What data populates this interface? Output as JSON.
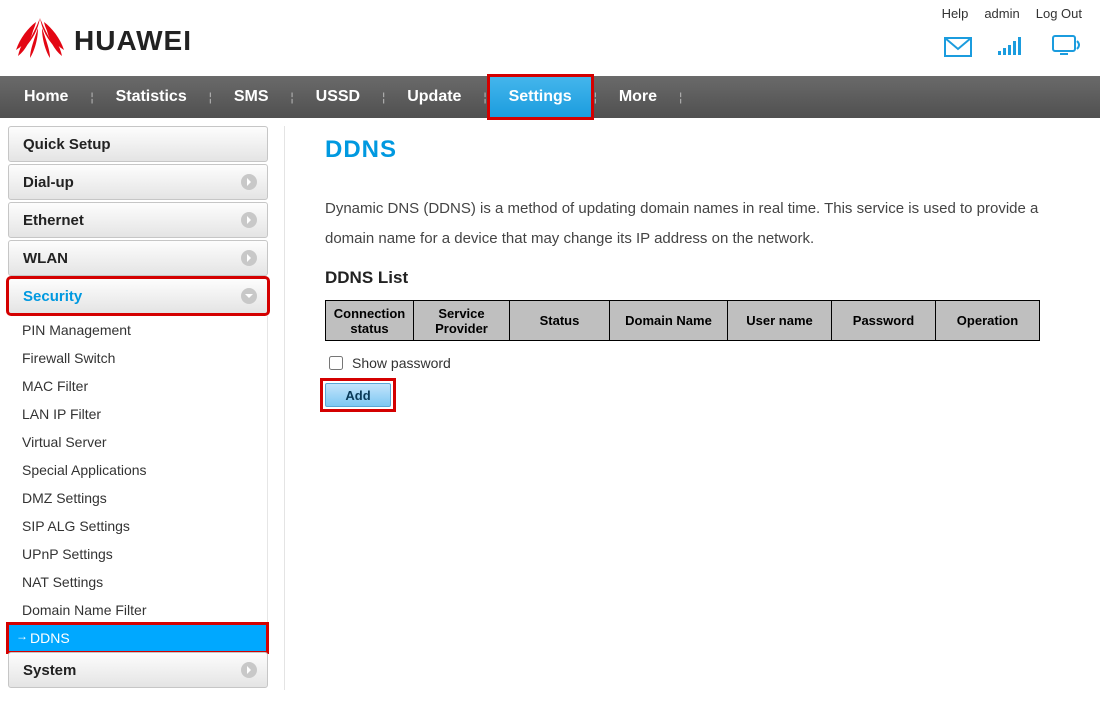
{
  "header": {
    "brand": "HUAWEI",
    "links": {
      "help": "Help",
      "user": "admin",
      "logout": "Log Out"
    }
  },
  "nav": {
    "home": "Home",
    "statistics": "Statistics",
    "sms": "SMS",
    "ussd": "USSD",
    "update": "Update",
    "settings": "Settings",
    "more": "More"
  },
  "sidebar": {
    "quick_setup": "Quick Setup",
    "dialup": "Dial-up",
    "ethernet": "Ethernet",
    "wlan": "WLAN",
    "security": "Security",
    "system": "System",
    "security_items": {
      "pin": "PIN Management",
      "firewall": "Firewall Switch",
      "mac": "MAC Filter",
      "lan_ip": "LAN IP Filter",
      "virtual": "Virtual Server",
      "special": "Special Applications",
      "dmz": "DMZ Settings",
      "sip": "SIP ALG Settings",
      "upnp": "UPnP Settings",
      "nat": "NAT Settings",
      "domain": "Domain Name Filter",
      "ddns": "DDNS"
    }
  },
  "main": {
    "title": "DDNS",
    "desc": "Dynamic DNS (DDNS) is a method of updating domain names in real time. This service is used to provide a domain name for a device that may change its IP address on the network.",
    "subtitle": "DDNS List",
    "cols": {
      "conn": "Connection status",
      "provider": "Service Provider",
      "status": "Status",
      "domain": "Domain Name",
      "user": "User name",
      "pass": "Password",
      "op": "Operation"
    },
    "show_password": "Show password",
    "add": "Add"
  }
}
